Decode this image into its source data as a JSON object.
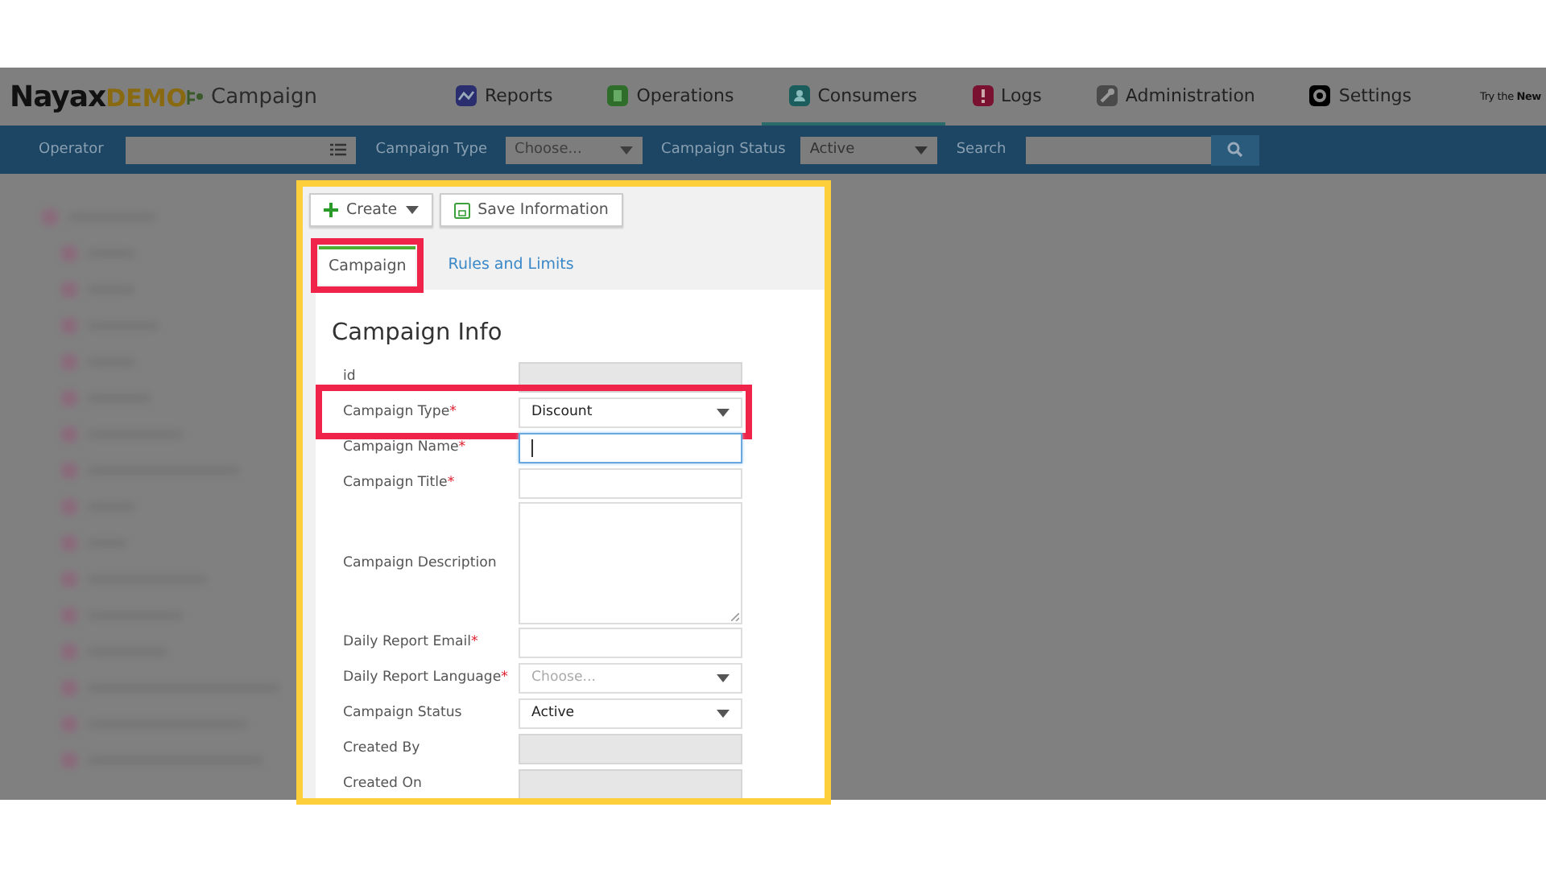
{
  "header": {
    "logo": "Nayax",
    "logo_suffix": "DEMO",
    "page_title": "Campaign",
    "try_new": "Try the **New**",
    "nav": [
      {
        "label": "Reports",
        "selected": false
      },
      {
        "label": "Operations",
        "selected": false
      },
      {
        "label": "Consumers",
        "selected": true
      },
      {
        "label": "Logs",
        "selected": false
      },
      {
        "label": "Administration",
        "selected": false
      },
      {
        "label": "Settings",
        "selected": false
      }
    ]
  },
  "filter_bar": {
    "operator_label": "Operator",
    "campaign_type_label": "Campaign Type",
    "campaign_type_placeholder": "Choose...",
    "campaign_status_label": "Campaign Status",
    "campaign_status_value": "Active",
    "search_label": "Search"
  },
  "panel": {
    "toolbar": [
      {
        "label": "Create",
        "kind": "create"
      },
      {
        "label": "Save Information",
        "kind": "save"
      }
    ],
    "tabs": [
      {
        "label": "Campaign",
        "selected": true,
        "highlighted": true
      },
      {
        "label": "Rules and Limits",
        "selected": false,
        "highlighted": false
      }
    ],
    "heading": "Campaign Info",
    "fields": [
      {
        "label": "id",
        "kind": "text",
        "disabled": true,
        "focused": false,
        "highlighted": false
      },
      {
        "label": "Campaign Type",
        "required_mark": "*",
        "kind": "select",
        "value": "Discount",
        "disabled": false,
        "focused": false,
        "highlighted": true
      },
      {
        "label": "Campaign Name",
        "required_mark": "*",
        "kind": "text",
        "disabled": false,
        "focused": true,
        "highlighted": false
      },
      {
        "label": "Campaign Title",
        "required_mark": "*",
        "kind": "text",
        "disabled": false,
        "focused": false,
        "highlighted": false
      },
      {
        "label": "Campaign Description",
        "kind": "textarea",
        "disabled": false,
        "focused": false,
        "highlighted": false
      },
      {
        "label": "Daily Report Email",
        "required_mark": "*",
        "kind": "text",
        "disabled": false,
        "focused": false,
        "highlighted": false
      },
      {
        "label": "Daily Report Language",
        "required_mark": "*",
        "kind": "select",
        "placeholder": "Choose...",
        "disabled": false,
        "focused": false,
        "highlighted": false
      },
      {
        "label": "Campaign Status",
        "kind": "select",
        "value": "Active",
        "disabled": false,
        "focused": false,
        "highlighted": false
      },
      {
        "label": "Created By",
        "kind": "text",
        "disabled": true,
        "focused": false,
        "highlighted": false
      },
      {
        "label": "Created On",
        "kind": "text",
        "disabled": true,
        "focused": false,
        "highlighted": false
      }
    ]
  }
}
